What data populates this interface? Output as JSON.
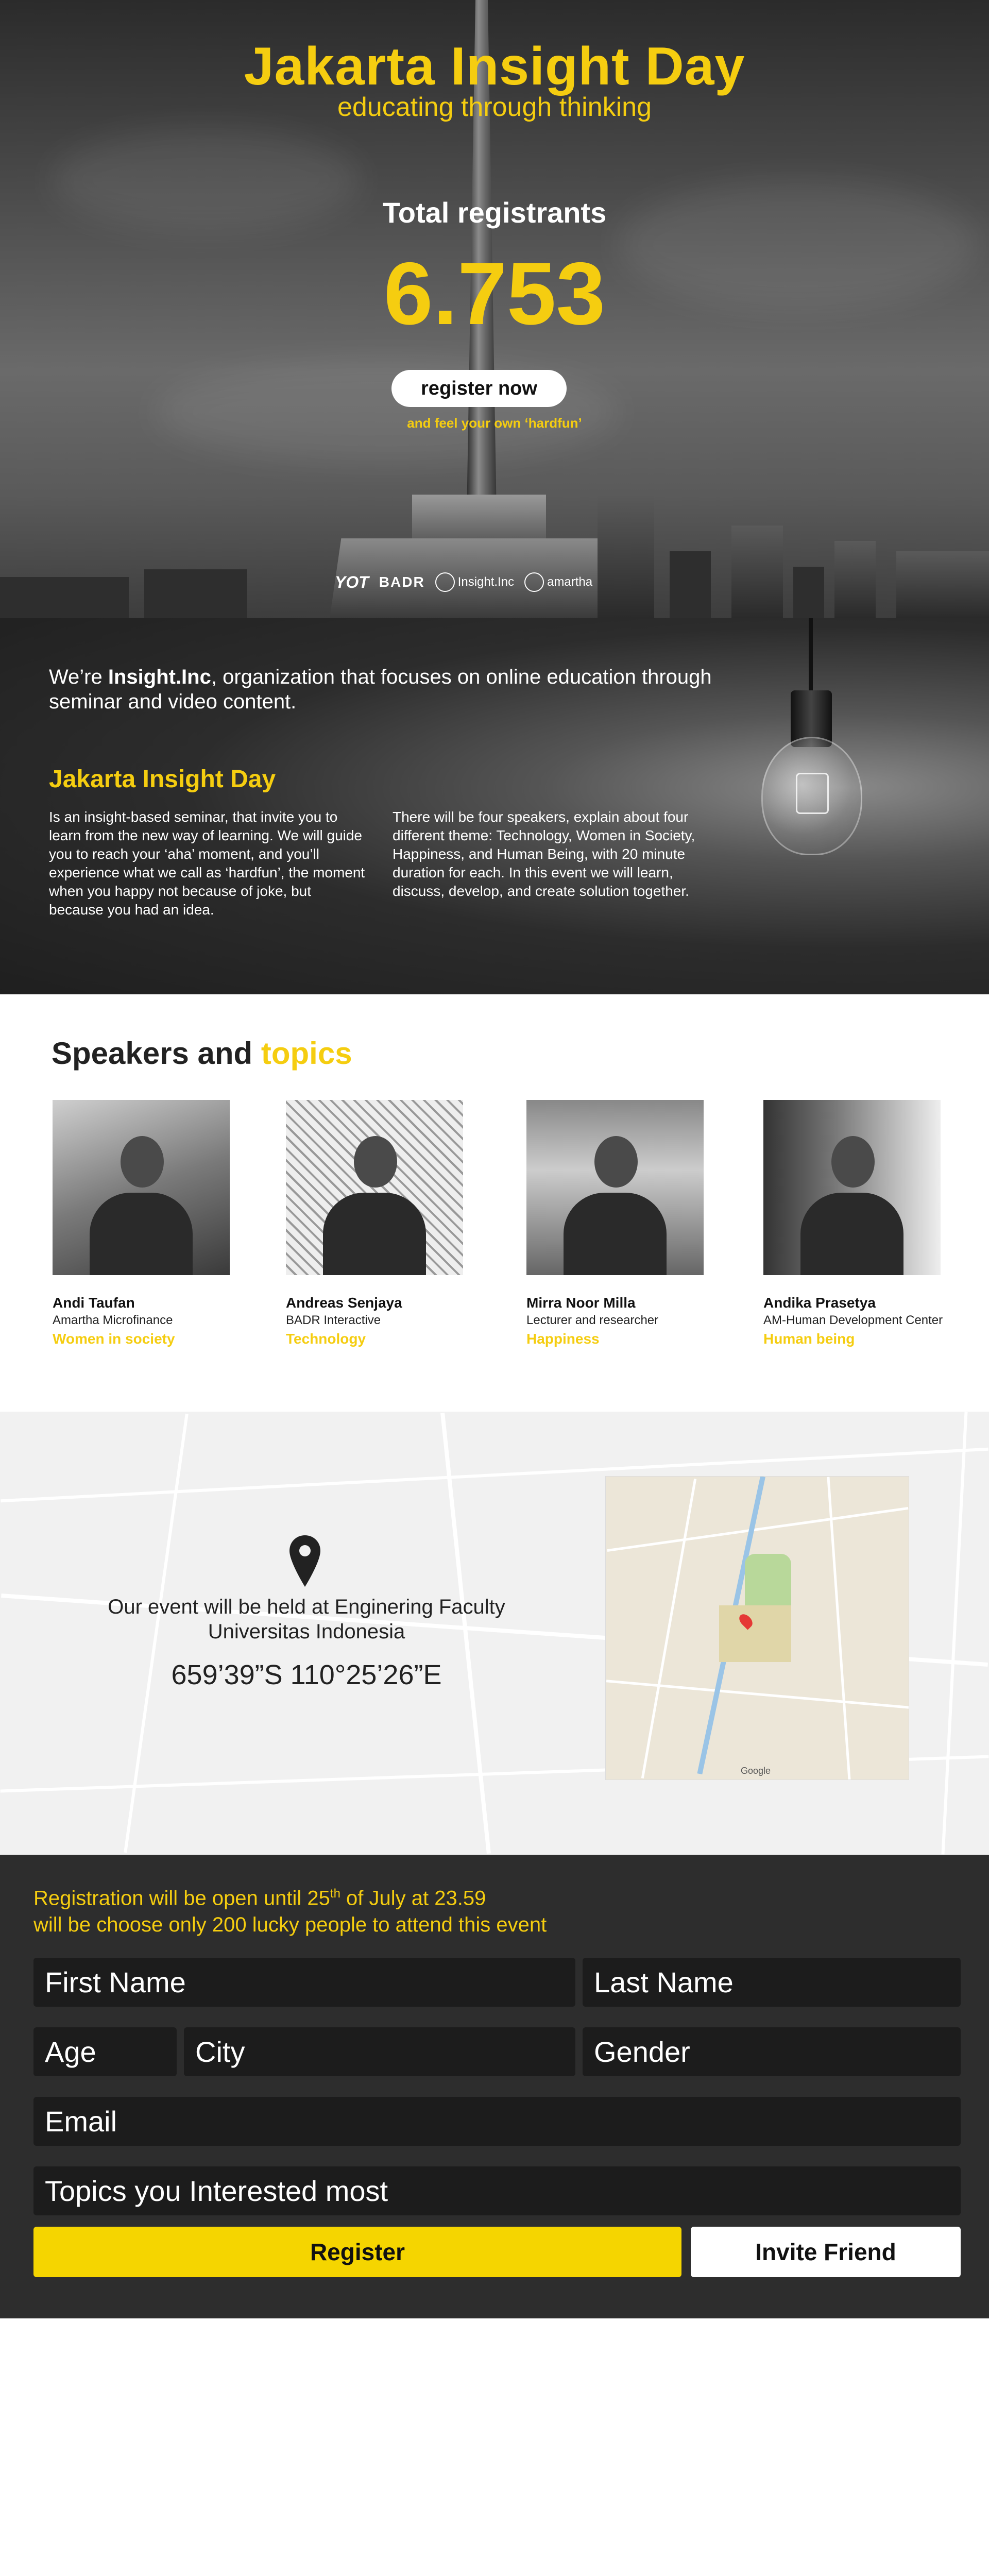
{
  "hero": {
    "title": "Jakarta Insight Day",
    "subtitle": "educating through thinking",
    "registrants_label": "Total registrants",
    "registrants_count": "6.753",
    "register_button": "register now",
    "tagline": "and feel your own ‘hardfun’",
    "sponsors": [
      "YOT",
      "BADR",
      "Insight.Inc",
      "amartha"
    ]
  },
  "about": {
    "intro_prefix": "We’re ",
    "intro_brand": "Insight.Inc",
    "intro_suffix": ", organization that focuses on online education through seminar and video content.",
    "title": "Jakarta Insight Day",
    "col1": "Is an insight-based seminar, that invite you to learn from the new way of learning. We will guide you to reach your ‘aha’ moment, and you’ll experience what we call as ‘hardfun’, the moment when you happy not because of joke, but because you had an idea.",
    "col2": "There will be four speakers, explain about four different theme: Technology, Women in Society, Happiness, and Human Being, with 20 minute duration for each. In this event we will learn, discuss, develop, and create solution together."
  },
  "speakers": {
    "title_part1": "Speakers and ",
    "title_part2": "topics",
    "items": [
      {
        "name": "Andi Taufan",
        "org": "Amartha Microfinance",
        "topic": "Women in society"
      },
      {
        "name": "Andreas Senjaya",
        "org": "BADR Interactive",
        "topic": "Technology"
      },
      {
        "name": "Mirra Noor Milla",
        "org": "Lecturer and researcher",
        "topic": "Happiness"
      },
      {
        "name": "Andika Prasetya",
        "org": "AM-Human Development Center",
        "topic": "Human being"
      }
    ]
  },
  "location": {
    "line1": "Our event will be held at Enginering Faculty",
    "line2": "Universitas Indonesia",
    "coordinates": "659’39”S 110°25’26”E",
    "map_credit": "Google"
  },
  "registration": {
    "info_line1_prefix": "Registration will be open until 25",
    "info_line1_sup": "th",
    "info_line1_suffix": " of July at 23.59",
    "info_line2": "will be choose only 200 lucky people to attend this event",
    "first_name": "First Name",
    "last_name": "Last Name",
    "age": "Age",
    "city": "City",
    "gender": "Gender",
    "email": "Email",
    "topics": "Topics you Interested most",
    "register_button": "Register",
    "invite_button": "Invite Friend"
  },
  "colors": {
    "accent": "#f5cd10",
    "dark_panel": "#2d2d2d",
    "field_bg": "#1c1c1c"
  }
}
